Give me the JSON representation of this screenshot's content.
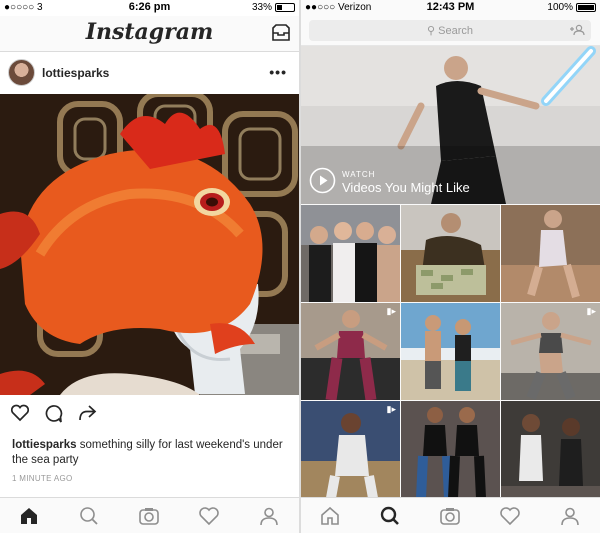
{
  "left_screen": {
    "status_bar": {
      "carrier": "●○○○○ 3",
      "time": "6:26 pm",
      "battery": "33%",
      "battery_level": 0.33
    },
    "header": {
      "logo": "Instagram",
      "inbox_icon": "inbox-tray-icon"
    },
    "post": {
      "username": "lottiesparks",
      "more": "•••",
      "caption_user": "lottiesparks",
      "caption_text": " something silly for last weekend's under the sea party",
      "time_ago": "1 MINUTE AGO",
      "photo_description_icon": "fish-hat-photo"
    },
    "actions": {
      "like_icon": "heart-icon",
      "comment_icon": "comment-icon",
      "share_icon": "share-arrow-icon"
    },
    "tabbar": [
      "home-icon",
      "search-icon",
      "camera-icon",
      "heart-icon",
      "profile-icon"
    ]
  },
  "right_screen": {
    "status_bar": {
      "carrier": "●●○○○ Verizon",
      "time": "12:43 PM",
      "battery": "100%",
      "battery_level": 1.0
    },
    "search": {
      "placeholder": "Search"
    },
    "video": {
      "label": "WATCH",
      "title": "Videos You Might Like"
    },
    "grid_video_badges": [
      4,
      6,
      7
    ],
    "tabbar": [
      "home-icon",
      "search-icon",
      "camera-icon",
      "heart-icon",
      "profile-icon"
    ]
  },
  "colors": {
    "text": "#262626",
    "muted": "#999999",
    "border": "#dbdbdb",
    "search_bg": "#ececec"
  }
}
